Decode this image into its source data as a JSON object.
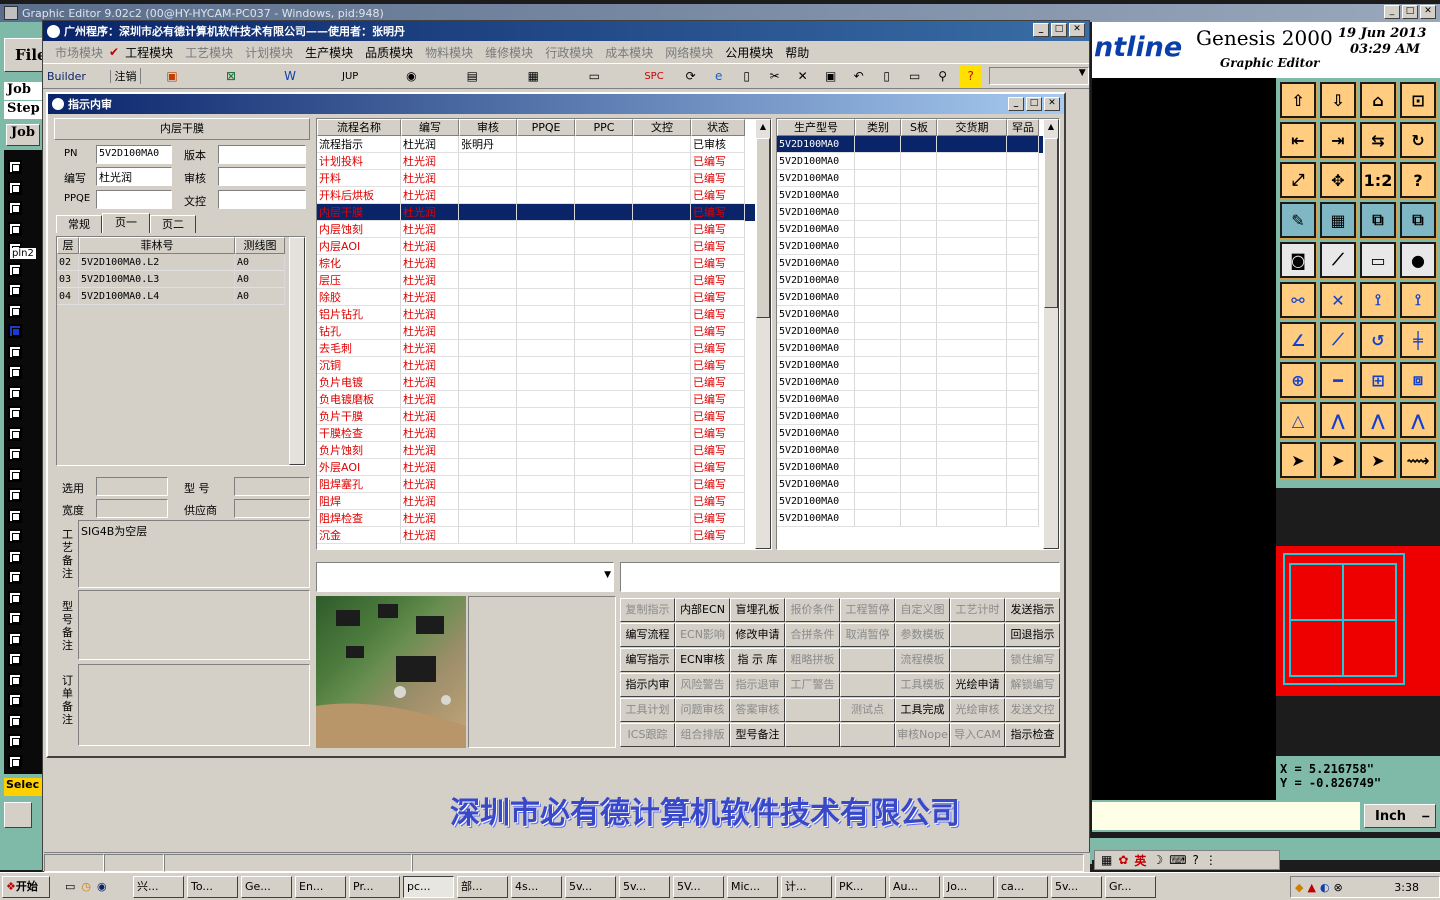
{
  "genesis": {
    "title": "Graphic Editor 9.02c2 (00@HY-HYCAM-PC037 - Windows, pid:948)",
    "logo_text": "ntline",
    "product": "Genesis 2000",
    "subtitle": "Graphic Editor",
    "date": "19 Jun 2013",
    "time": "03:29 AM",
    "file_menu": "File",
    "job_label": "Job",
    "step_label": "Step",
    "job_button": "Job",
    "layer_label": "pln2",
    "select_label": "Selec",
    "coord_x": "X = 5.216758\"",
    "coord_y": "Y = -0.826749\"",
    "units": "Inch"
  },
  "app": {
    "title": "广州程序：深圳市必有德计算机软件技术有限公司——使用者：张明丹",
    "menu": [
      "市场模块",
      "工程模块",
      "工艺模块",
      "计划模块",
      "生产模块",
      "品质模块",
      "物料模块",
      "维修模块",
      "行政模块",
      "成本模块",
      "网络模块",
      "公用模块",
      "帮助"
    ],
    "menu_active": [
      false,
      true,
      false,
      false,
      true,
      true,
      false,
      false,
      false,
      false,
      false,
      true,
      true
    ],
    "toolbar_builder": "Builder",
    "toolbar_logout": "注销",
    "toolbar_jup": "JUP",
    "toolbar_spc": "SPC",
    "company_banner": "深圳市必有德计算机软件技术有限公司"
  },
  "dialog": {
    "title": "指示内审",
    "panel_title": "内层干膜",
    "pn_label": "PN",
    "pn_value": "5V2D100MA0",
    "version_label": "版本",
    "editor_label": "编写",
    "editor_value": "杜光润",
    "review_label": "审核",
    "ppqe_label": "PPQE",
    "docctrl_label": "文控",
    "tabs": [
      "常规",
      "页一",
      "页二"
    ],
    "film_headers": [
      "层",
      "菲林号",
      "测线图"
    ],
    "film_rows": [
      [
        "02",
        "5V2D100MA0.L2",
        "A0"
      ],
      [
        "03",
        "5V2D100MA0.L3",
        "A0"
      ],
      [
        "04",
        "5V2D100MA0.L4",
        "A0"
      ]
    ],
    "select_label": "选用",
    "model_label": "型  号",
    "width_label": "宽度",
    "supplier_label": "供应商",
    "process_note_label": "工艺备注",
    "process_note_value": "SIG4B为空层",
    "model_note_label": "型号备注",
    "order_note_label": "订单备注",
    "flow_headers": [
      "流程名称",
      "编写",
      "审核",
      "PPQE",
      "PPC",
      "文控",
      "状态"
    ],
    "flow_rows": [
      {
        "name": "流程指示",
        "editor": "杜光润",
        "reviewer": "张明丹",
        "status": "已审核",
        "kind": "normal"
      },
      {
        "name": "计划投料",
        "editor": "杜光润",
        "reviewer": "",
        "status": "已编写",
        "kind": "red"
      },
      {
        "name": "开料",
        "editor": "杜光润",
        "reviewer": "",
        "status": "已编写",
        "kind": "red"
      },
      {
        "name": "开料后烘板",
        "editor": "杜光润",
        "reviewer": "",
        "status": "已编写",
        "kind": "red"
      },
      {
        "name": "内层干膜",
        "editor": "杜光润",
        "reviewer": "",
        "status": "已编写",
        "kind": "selected"
      },
      {
        "name": "内层蚀刻",
        "editor": "杜光润",
        "reviewer": "",
        "status": "已编写",
        "kind": "red"
      },
      {
        "name": "内层AOI",
        "editor": "杜光润",
        "reviewer": "",
        "status": "已编写",
        "kind": "red"
      },
      {
        "name": "棕化",
        "editor": "杜光润",
        "reviewer": "",
        "status": "已编写",
        "kind": "red"
      },
      {
        "name": "层压",
        "editor": "杜光润",
        "reviewer": "",
        "status": "已编写",
        "kind": "red"
      },
      {
        "name": "除胶",
        "editor": "杜光润",
        "reviewer": "",
        "status": "已编写",
        "kind": "red"
      },
      {
        "name": "铝片钻孔",
        "editor": "杜光润",
        "reviewer": "",
        "status": "已编写",
        "kind": "red"
      },
      {
        "name": "钻孔",
        "editor": "杜光润",
        "reviewer": "",
        "status": "已编写",
        "kind": "red"
      },
      {
        "name": "去毛刺",
        "editor": "杜光润",
        "reviewer": "",
        "status": "已编写",
        "kind": "red"
      },
      {
        "name": "沉铜",
        "editor": "杜光润",
        "reviewer": "",
        "status": "已编写",
        "kind": "red"
      },
      {
        "name": "负片电镀",
        "editor": "杜光润",
        "reviewer": "",
        "status": "已编写",
        "kind": "red"
      },
      {
        "name": "负电镀磨板",
        "editor": "杜光润",
        "reviewer": "",
        "status": "已编写",
        "kind": "red"
      },
      {
        "name": "负片干膜",
        "editor": "杜光润",
        "reviewer": "",
        "status": "已编写",
        "kind": "red"
      },
      {
        "name": "干膜检查",
        "editor": "杜光润",
        "reviewer": "",
        "status": "已编写",
        "kind": "red"
      },
      {
        "name": "负片蚀刻",
        "editor": "杜光润",
        "reviewer": "",
        "status": "已编写",
        "kind": "red"
      },
      {
        "name": "外层AOI",
        "editor": "杜光润",
        "reviewer": "",
        "status": "已编写",
        "kind": "red"
      },
      {
        "name": "阻焊塞孔",
        "editor": "杜光润",
        "reviewer": "",
        "status": "已编写",
        "kind": "red"
      },
      {
        "name": "阻焊",
        "editor": "杜光润",
        "reviewer": "",
        "status": "已编写",
        "kind": "red"
      },
      {
        "name": "阻焊检查",
        "editor": "杜光润",
        "reviewer": "",
        "status": "已编写",
        "kind": "red"
      },
      {
        "name": "沉金",
        "editor": "杜光润",
        "reviewer": "",
        "status": "已编写",
        "kind": "red"
      }
    ],
    "model_headers": [
      "生产型号",
      "类别",
      "S板",
      "交货期",
      "罕品"
    ],
    "model_rows": [
      "5V2D100MA0",
      "5V2D100MA0",
      "5V2D100MA0",
      "5V2D100MA0",
      "5V2D100MA0",
      "5V2D100MA0",
      "5V2D100MA0",
      "5V2D100MA0",
      "5V2D100MA0",
      "5V2D100MA0",
      "5V2D100MA0",
      "5V2D100MA0",
      "5V2D100MA0",
      "5V2D100MA0",
      "5V2D100MA0",
      "5V2D100MA0",
      "5V2D100MA0",
      "5V2D100MA0",
      "5V2D100MA0",
      "5V2D100MA0",
      "5V2D100MA0",
      "5V2D100MA0",
      "5V2D100MA0"
    ],
    "action_buttons": [
      [
        {
          "t": "复制指示",
          "on": false
        },
        {
          "t": "内部ECN",
          "on": true
        },
        {
          "t": "盲埋孔板",
          "on": true
        },
        {
          "t": "报价条件",
          "on": false
        },
        {
          "t": "工程暂停",
          "on": false
        },
        {
          "t": "自定义图",
          "on": false
        },
        {
          "t": "工艺计时",
          "on": false
        },
        {
          "t": "发送指示",
          "on": true
        }
      ],
      [
        {
          "t": "编写流程",
          "on": true
        },
        {
          "t": "ECN影响",
          "on": false
        },
        {
          "t": "修改申请",
          "on": true
        },
        {
          "t": "合拼条件",
          "on": false
        },
        {
          "t": "取消暂停",
          "on": false
        },
        {
          "t": "参数模板",
          "on": false
        },
        {
          "t": "",
          "on": false
        },
        {
          "t": "回退指示",
          "on": true
        }
      ],
      [
        {
          "t": "编写指示",
          "on": true
        },
        {
          "t": "ECN审核",
          "on": true
        },
        {
          "t": "指 示 库",
          "on": true
        },
        {
          "t": "粗略拼板",
          "on": false
        },
        {
          "t": "",
          "on": false
        },
        {
          "t": "流程模板",
          "on": false
        },
        {
          "t": "",
          "on": false
        },
        {
          "t": "锁住编写",
          "on": false
        }
      ],
      [
        {
          "t": "指示内审",
          "on": true
        },
        {
          "t": "风险警告",
          "on": false
        },
        {
          "t": "指示退审",
          "on": false
        },
        {
          "t": "工厂警告",
          "on": false
        },
        {
          "t": "",
          "on": false
        },
        {
          "t": "工具模板",
          "on": false
        },
        {
          "t": "光绘申请",
          "on": true
        },
        {
          "t": "解锁编写",
          "on": false
        }
      ],
      [
        {
          "t": "工具计划",
          "on": false
        },
        {
          "t": "问题审核",
          "on": false
        },
        {
          "t": "答案审核",
          "on": false
        },
        {
          "t": "",
          "on": false
        },
        {
          "t": "测试点",
          "on": false
        },
        {
          "t": "工具完成",
          "on": true
        },
        {
          "t": "光绘审核",
          "on": false
        },
        {
          "t": "发送文控",
          "on": false
        }
      ],
      [
        {
          "t": "ICS跟踪",
          "on": false
        },
        {
          "t": "组合排版",
          "on": false
        },
        {
          "t": "型号备注",
          "on": true
        },
        {
          "t": "",
          "on": false
        },
        {
          "t": "",
          "on": false
        },
        {
          "t": "审核Nope",
          "on": false
        },
        {
          "t": "导入CAM",
          "on": false
        },
        {
          "t": "指示检查",
          "on": true
        }
      ]
    ]
  },
  "taskbar": {
    "start": "开始",
    "items": [
      "兴...",
      "To...",
      "Ge...",
      "En...",
      "Pr...",
      "pc...",
      "部...",
      "4s...",
      "5v...",
      "5v...",
      "5V...",
      "Mic...",
      "计...",
      "PK...",
      "Au...",
      "Jo...",
      "ca...",
      "5v...",
      "Gr..."
    ],
    "clock": "3:38"
  },
  "ime": {
    "lang": "英"
  }
}
